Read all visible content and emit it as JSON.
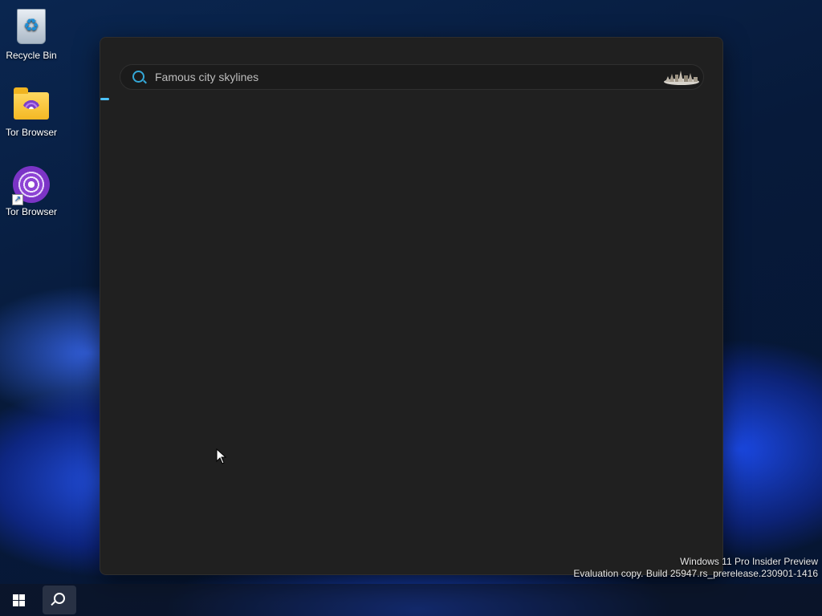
{
  "desktop": {
    "icons": [
      {
        "label": "Recycle Bin",
        "icon": "recycle-bin-icon"
      },
      {
        "label": "Tor Browser",
        "icon": "folder-icon"
      },
      {
        "label": "Tor Browser",
        "icon": "tor-browser-icon"
      }
    ]
  },
  "search": {
    "placeholder": "Famous city skylines",
    "query": "",
    "icon": "search-icon",
    "highlight_icon": "city-skyline-icon"
  },
  "watermark": {
    "line1": "Windows 11 Pro Insider Preview",
    "line2": "Evaluation copy. Build 25947.rs_prerelease.230901-1416"
  },
  "taskbar": {
    "start_icon": "windows-logo-icon",
    "search_icon": "search-icon"
  },
  "colors": {
    "accent": "#4cc2ff",
    "panel_bg": "#202020",
    "search_icon": "#34a8d8"
  }
}
